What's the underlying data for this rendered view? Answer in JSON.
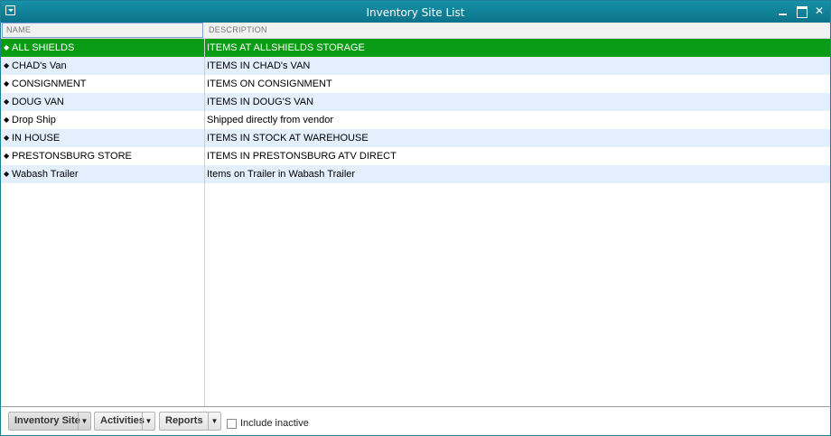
{
  "window": {
    "title": "Inventory Site List"
  },
  "columns": {
    "name": "NAME",
    "description": "DESCRIPTION"
  },
  "rows": [
    {
      "name": "ALL SHIELDS",
      "description": "ITEMS AT ALLSHIELDS STORAGE"
    },
    {
      "name": "CHAD's Van",
      "description": "ITEMS IN CHAD's VAN"
    },
    {
      "name": "CONSIGNMENT",
      "description": "ITEMS ON CONSIGNMENT"
    },
    {
      "name": "DOUG VAN",
      "description": "ITEMS IN DOUG'S VAN"
    },
    {
      "name": "Drop Ship",
      "description": "Shipped directly from vendor"
    },
    {
      "name": "IN HOUSE",
      "description": "ITEMS IN STOCK AT WAREHOUSE"
    },
    {
      "name": "PRESTONSBURG STORE",
      "description": "ITEMS IN PRESTONSBURG ATV DIRECT"
    },
    {
      "name": "Wabash Trailer",
      "description": "Items on Trailer in Wabash Trailer"
    }
  ],
  "footer": {
    "inventory_site_label": "Inventory Site",
    "activities_label": "Activities",
    "reports_label": "Reports",
    "include_inactive_label": "Include inactive",
    "include_inactive_checked": false
  },
  "colors": {
    "titlebar": "#0b7389",
    "selected_row": "#0b9c16",
    "alt_row": "#e3effd"
  }
}
